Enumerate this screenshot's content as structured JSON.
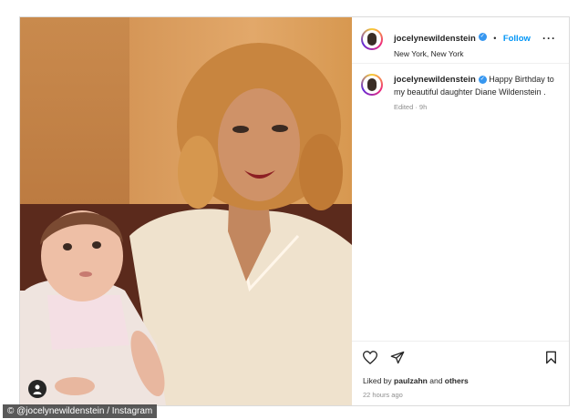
{
  "post": {
    "username": "jocelynewildenstein",
    "follow_separator": "•",
    "follow_label": "Follow",
    "location": "New York, New York",
    "more_icon": "···",
    "caption_username": "jocelynewildenstein",
    "caption_text": "Happy Birthday to my beautiful daughter Diane Wildenstein .",
    "caption_meta": "Edited · 9h",
    "likes_prefix": "Liked by ",
    "liked_by_user": "paulzahn",
    "likes_and": " and ",
    "likes_others": "others",
    "time_ago": "22 hours ago"
  },
  "icons": {
    "verified": "verified-badge-icon",
    "like": "heart-icon",
    "share": "paper-plane-icon",
    "save": "bookmark-icon",
    "tags": "person-tag-icon"
  },
  "photo_credit": "© @jocelynewildenstein / Instagram",
  "colors": {
    "link_blue": "#0095f6",
    "verified_blue": "#3797f0",
    "muted_gray": "#8e8e8e",
    "text_dark": "#262626"
  }
}
